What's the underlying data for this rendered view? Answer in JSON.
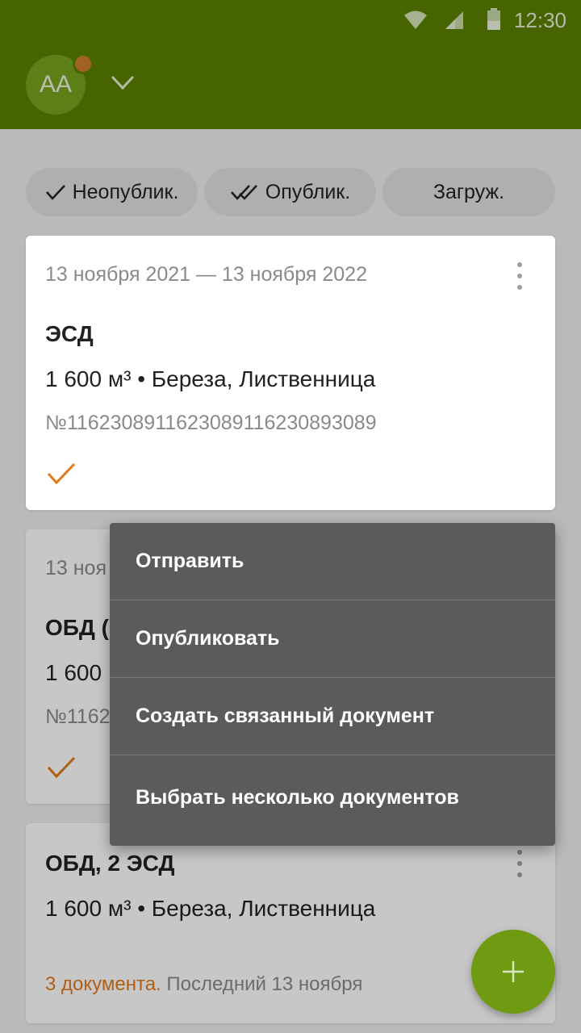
{
  "status_bar": {
    "time": "12:30",
    "icons": [
      "wifi-icon",
      "signal-icon",
      "battery-icon"
    ]
  },
  "app_bar": {
    "avatar_initials": "AA",
    "has_notification_dot": true
  },
  "filters": [
    {
      "label": "Неопублик.",
      "icon": "check-icon"
    },
    {
      "label": "Опублик.",
      "icon": "double-check-icon"
    },
    {
      "label": "Загруж.",
      "icon": ""
    }
  ],
  "cards": [
    {
      "dates": "13 ноября 2021 — 13 ноября 2022",
      "title": "ЭСД",
      "desc": "1 600 м³ • Береза, Лиственница",
      "number": "№11623089116230891162308930​89",
      "status_icon": "check-icon"
    },
    {
      "dates": "13 ноя",
      "title": "ОБД (",
      "desc": "1 600",
      "number": "№1162",
      "status_icon": "check-icon"
    },
    {
      "title": "ОБД, 2 ЭСД",
      "desc": "1 600 м³ • Береза, Лиственница",
      "footer_accent": "3 документа.",
      "footer_rest": " Последний 13 ноября"
    }
  ],
  "context_menu": [
    "Отправить",
    "Опубликовать",
    "Создать связанный документ",
    "Выбрать несколько документов"
  ],
  "fab": {
    "icon": "plus-icon"
  },
  "colors": {
    "primary": "#5a8200",
    "accent": "#e07b1b",
    "menu_bg": "#5b5b5b"
  }
}
